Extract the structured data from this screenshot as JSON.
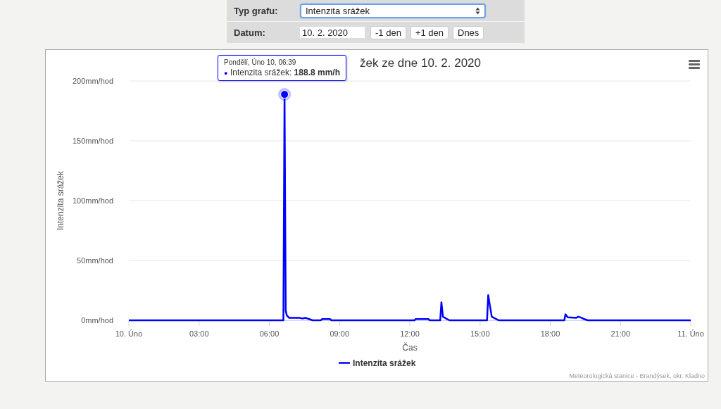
{
  "form": {
    "rows": [
      {
        "kind": "select",
        "label": "Typ grafu:",
        "value": "Intenzita srážek",
        "focused": true
      },
      {
        "kind": "date",
        "label": "Datum:",
        "value": "10. 2. 2020",
        "buttons": [
          "-1 den",
          "+1 den",
          "Dnes"
        ]
      }
    ]
  },
  "chart": {
    "title": "žek ze dne 10. 2. 2020",
    "tooltip": {
      "header": "Pondělí, Úno 10, 06:39",
      "marker": "●",
      "text": "Intenzita srážek: **188.8 mm/h**"
    },
    "credits": "Meteorologická stanice - Brandýsek, okr. Kladno",
    "chart_data": {
      "type": "line",
      "xlabel": "Čas",
      "ylabel": "Intenzita srážek",
      "grid": true,
      "x": [
        "2020-02-10T00:00",
        "2020-02-10T06:36",
        "2020-02-10T06:39",
        "2020-02-10T06:42",
        "2020-02-10T06:45",
        "2020-02-10T06:51",
        "2020-02-10T07:18",
        "2020-02-10T07:24",
        "2020-02-10T07:33",
        "2020-02-10T07:42",
        "2020-02-10T07:51",
        "2020-02-10T08:12",
        "2020-02-10T08:15",
        "2020-02-10T08:36",
        "2020-02-10T08:39",
        "2020-02-10T12:12",
        "2020-02-10T12:15",
        "2020-02-10T12:48",
        "2020-02-10T12:51",
        "2020-02-10T13:18",
        "2020-02-10T13:21",
        "2020-02-10T13:25",
        "2020-02-10T13:36",
        "2020-02-10T13:42",
        "2020-02-10T15:18",
        "2020-02-10T15:21",
        "2020-02-10T15:25",
        "2020-02-10T15:30",
        "2020-02-10T15:42",
        "2020-02-10T15:48",
        "2020-02-10T18:36",
        "2020-02-10T18:39",
        "2020-02-10T18:45",
        "2020-02-10T19:06",
        "2020-02-10T19:12",
        "2020-02-10T19:21",
        "2020-02-10T19:27",
        "2020-02-10T19:36",
        "2020-02-11T00:00"
      ],
      "series": [
        {
          "name": "Intenzita srážek",
          "color": "#0000ff",
          "values": [
            0,
            0,
            188.8,
            8,
            4,
            2,
            2,
            1.5,
            2,
            1,
            0,
            0,
            1,
            1,
            0,
            0,
            1,
            1,
            0,
            0,
            15,
            3,
            1,
            0,
            0,
            21,
            13,
            3,
            1,
            0,
            0,
            5,
            2.5,
            2,
            3,
            2,
            1,
            0,
            0
          ]
        }
      ],
      "xlim": [
        "2020-02-10T00:00",
        "2020-02-11T00:00"
      ],
      "ylim": [
        0,
        200
      ],
      "xticks": [
        {
          "value": "2020-02-10T00:00",
          "label": "10. Úno"
        },
        {
          "value": "2020-02-10T03:00",
          "label": "03:00"
        },
        {
          "value": "2020-02-10T06:00",
          "label": "06:00"
        },
        {
          "value": "2020-02-10T09:00",
          "label": "09:00"
        },
        {
          "value": "2020-02-10T12:00",
          "label": "12:00"
        },
        {
          "value": "2020-02-10T15:00",
          "label": "15:00"
        },
        {
          "value": "2020-02-10T18:00",
          "label": "18:00"
        },
        {
          "value": "2020-02-10T21:00",
          "label": "21:00"
        },
        {
          "value": "2020-02-11T00:00",
          "label": "11. Úno"
        }
      ],
      "yticks": [
        {
          "value": 0,
          "label": "0mm/hod"
        },
        {
          "value": 50,
          "label": "50mm/hod"
        },
        {
          "value": 100,
          "label": "100mm/hod"
        },
        {
          "value": 150,
          "label": "150mm/hod"
        },
        {
          "value": 200,
          "label": "200mm/hod"
        }
      ]
    }
  }
}
